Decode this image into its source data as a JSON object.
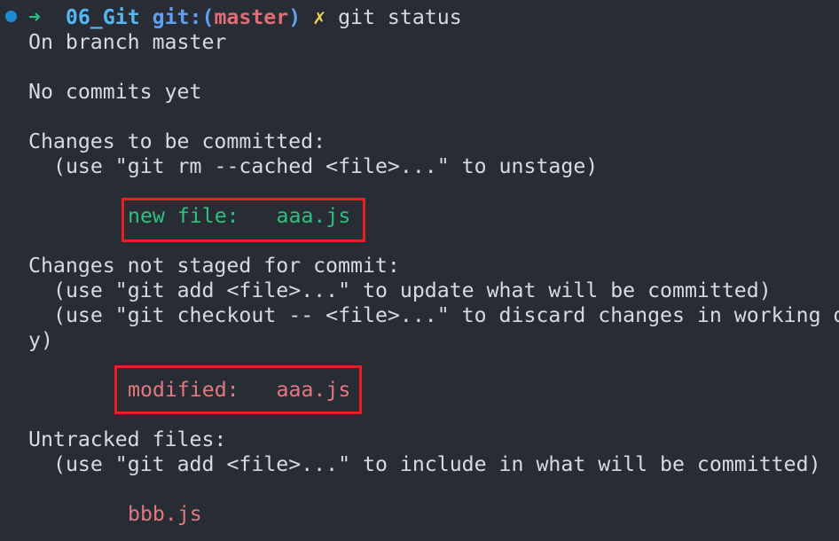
{
  "prompt": {
    "arrow": "➜",
    "directory": "06_Git",
    "git_label": "git:(",
    "branch": "master",
    "git_close": ")",
    "dirty_mark": "✗",
    "command": "git status"
  },
  "output": {
    "on_branch": "On branch master",
    "no_commits": "No commits yet",
    "staged_header": "Changes to be committed:",
    "staged_hint": "(use \"git rm --cached <file>...\" to unstage)",
    "staged_file": "new file:   aaa.js",
    "unstaged_header": "Changes not staged for commit:",
    "unstaged_hint1": "(use \"git add <file>...\" to update what will be committed)",
    "unstaged_hint2": "(use \"git checkout -- <file>...\" to discard changes in working d",
    "unstaged_hint2_wrap": "y)",
    "unstaged_file": "modified:   aaa.js",
    "untracked_header": "Untracked files:",
    "untracked_hint": "(use \"git add <file>...\" to include in what will be committed)",
    "untracked_file": "bbb.js"
  },
  "colors": {
    "background": "#282c34",
    "text": "#d7dae0",
    "staged": "#2fc080",
    "unstaged": "#e07a7e",
    "highlight_border": "#ea1f26",
    "prompt_arrow": "#23c483",
    "prompt_dir": "#56b6f0",
    "prompt_branch": "#e06c75",
    "prompt_dirty": "#f0d44e"
  }
}
